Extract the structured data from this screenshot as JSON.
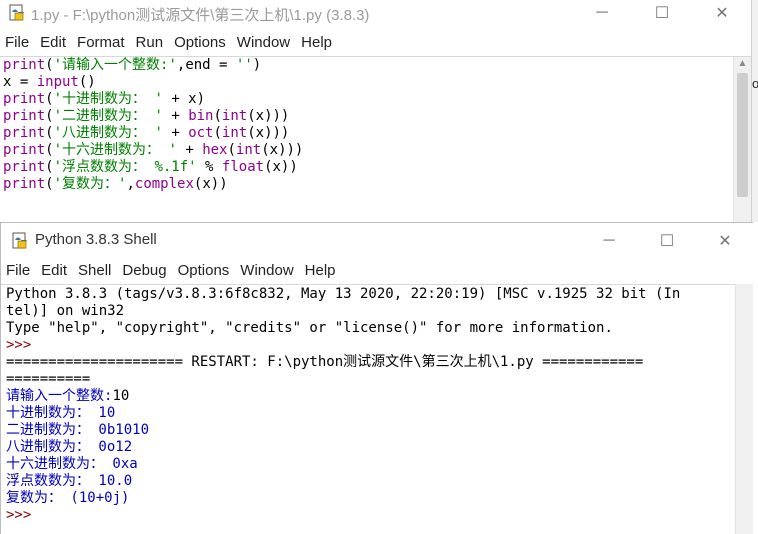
{
  "editor": {
    "title": "1.py - F:\\python测试源文件\\第三次上机\\1.py (3.8.3)",
    "menu": [
      "File",
      "Edit",
      "Format",
      "Run",
      "Options",
      "Window",
      "Help"
    ],
    "lines": [
      [
        {
          "t": "print",
          "c": "kw"
        },
        {
          "t": "(",
          "c": ""
        },
        {
          "t": "'请输入一个整数:'",
          "c": "str"
        },
        {
          "t": ",end = ",
          "c": ""
        },
        {
          "t": "''",
          "c": "str"
        },
        {
          "t": ")",
          "c": ""
        }
      ],
      [
        {
          "t": "x = ",
          "c": ""
        },
        {
          "t": "input",
          "c": "kw"
        },
        {
          "t": "()",
          "c": ""
        }
      ],
      [
        {
          "t": "print",
          "c": "kw"
        },
        {
          "t": "(",
          "c": ""
        },
        {
          "t": "'十进制数为： '",
          "c": "str"
        },
        {
          "t": " + x)",
          "c": ""
        }
      ],
      [
        {
          "t": "print",
          "c": "kw"
        },
        {
          "t": "(",
          "c": ""
        },
        {
          "t": "'二进制数为： '",
          "c": "str"
        },
        {
          "t": " + ",
          "c": ""
        },
        {
          "t": "bin",
          "c": "kw"
        },
        {
          "t": "(",
          "c": ""
        },
        {
          "t": "int",
          "c": "kw"
        },
        {
          "t": "(x)))",
          "c": ""
        }
      ],
      [
        {
          "t": "print",
          "c": "kw"
        },
        {
          "t": "(",
          "c": ""
        },
        {
          "t": "'八进制数为： '",
          "c": "str"
        },
        {
          "t": " + ",
          "c": ""
        },
        {
          "t": "oct",
          "c": "kw"
        },
        {
          "t": "(",
          "c": ""
        },
        {
          "t": "int",
          "c": "kw"
        },
        {
          "t": "(x)))",
          "c": ""
        }
      ],
      [
        {
          "t": "print",
          "c": "kw"
        },
        {
          "t": "(",
          "c": ""
        },
        {
          "t": "'十六进制数为： '",
          "c": "str"
        },
        {
          "t": " + ",
          "c": ""
        },
        {
          "t": "hex",
          "c": "kw"
        },
        {
          "t": "(",
          "c": ""
        },
        {
          "t": "int",
          "c": "kw"
        },
        {
          "t": "(x)))",
          "c": ""
        }
      ],
      [
        {
          "t": "print",
          "c": "kw"
        },
        {
          "t": "(",
          "c": ""
        },
        {
          "t": "'浮点数数为： %.1f'",
          "c": "str"
        },
        {
          "t": " % ",
          "c": ""
        },
        {
          "t": "float",
          "c": "kw"
        },
        {
          "t": "(x))",
          "c": ""
        }
      ],
      [
        {
          "t": "print",
          "c": "kw"
        },
        {
          "t": "(",
          "c": ""
        },
        {
          "t": "'复数为：'",
          "c": "str"
        },
        {
          "t": ",",
          "c": ""
        },
        {
          "t": "complex",
          "c": "kw"
        },
        {
          "t": "(x))",
          "c": ""
        }
      ]
    ]
  },
  "shell": {
    "title": "Python 3.8.3 Shell",
    "menu": [
      "File",
      "Edit",
      "Shell",
      "Debug",
      "Options",
      "Window",
      "Help"
    ],
    "lines": [
      [
        {
          "t": "Python 3.8.3 (tags/v3.8.3:6f8c832, May 13 2020, 22:20:19) [MSC v.1925 32 bit (In",
          "c": ""
        }
      ],
      [
        {
          "t": "tel)] on win32",
          "c": ""
        }
      ],
      [
        {
          "t": "Type \"help\", \"copyright\", \"credits\" or \"license()\" for more information.",
          "c": ""
        }
      ],
      [
        {
          "t": ">>> ",
          "c": "prompt"
        }
      ],
      [
        {
          "t": "===================== RESTART: F:\\python测试源文件\\第三次上机\\1.py ============",
          "c": ""
        }
      ],
      [
        {
          "t": "==========",
          "c": ""
        }
      ],
      [
        {
          "t": "请输入一个整数:",
          "c": "out"
        },
        {
          "t": "10",
          "c": ""
        }
      ],
      [
        {
          "t": "十进制数为： 10",
          "c": "out"
        }
      ],
      [
        {
          "t": "二进制数为： 0b1010",
          "c": "out"
        }
      ],
      [
        {
          "t": "八进制数为： 0o12",
          "c": "out"
        }
      ],
      [
        {
          "t": "十六进制数为： 0xa",
          "c": "out"
        }
      ],
      [
        {
          "t": "浮点数数为： 10.0",
          "c": "out"
        }
      ],
      [
        {
          "t": "复数为： (10+0j)",
          "c": "out"
        }
      ],
      [
        {
          "t": ">>> ",
          "c": "prompt"
        }
      ]
    ]
  },
  "window_controls": {
    "minimize": "─",
    "maximize": "☐",
    "close": "✕"
  },
  "background_peek": "o"
}
